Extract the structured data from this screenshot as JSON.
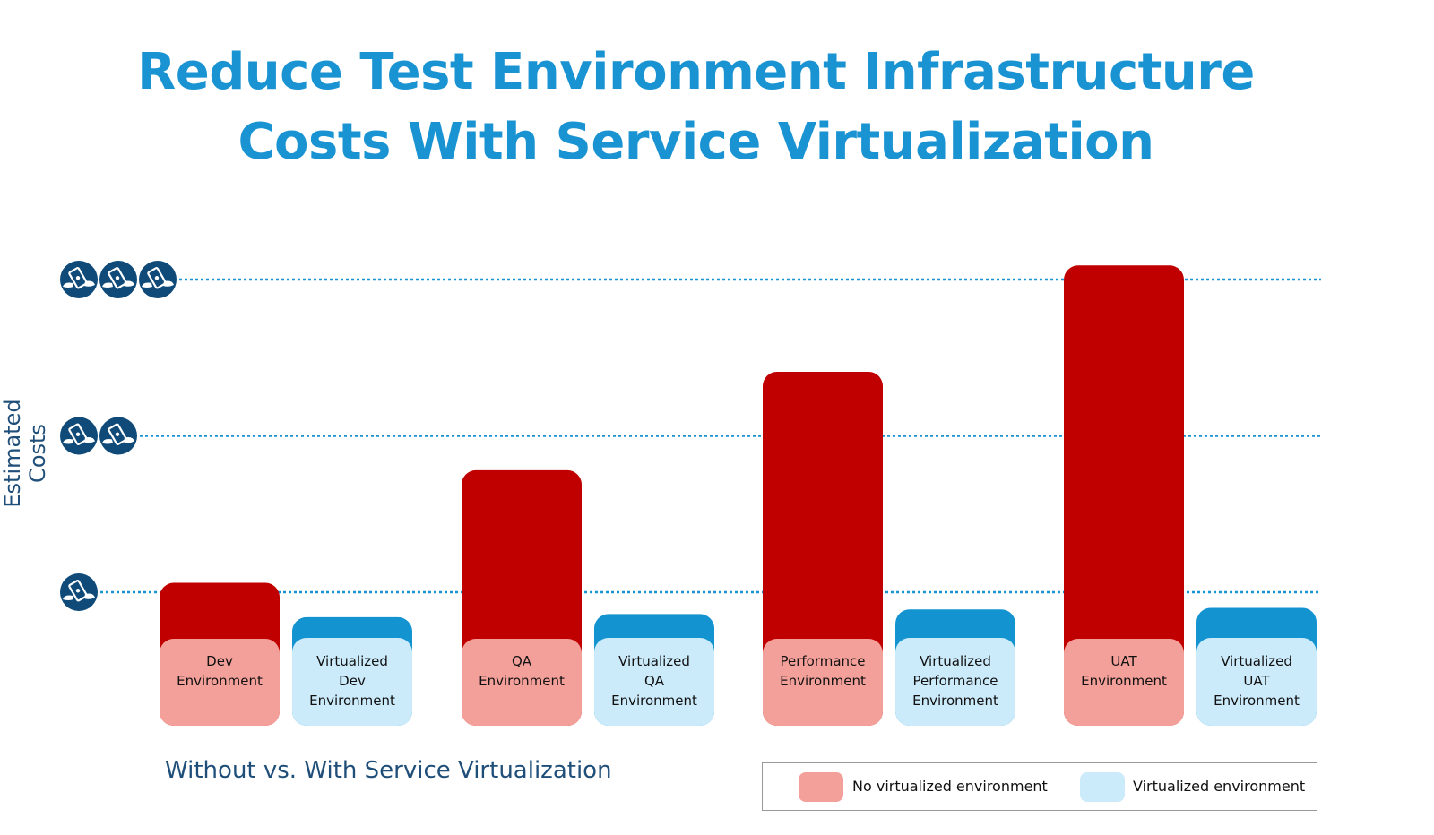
{
  "chart_data": {
    "type": "bar",
    "title": "Reduce Test Environment Infrastructure Costs With Service Virtualization",
    "title_lines": [
      "Reduce Test Environment Infrastructure",
      "Costs With Service Virtualization"
    ],
    "xlabel": "Without vs. With Service Virtualization",
    "ylabel": "Estimated Costs",
    "y_ticks": [
      {
        "value": 1,
        "icon_count": 1,
        "icon": "money-with-wings-icon"
      },
      {
        "value": 2,
        "icon_count": 2,
        "icon": "money-with-wings-icon"
      },
      {
        "value": 3,
        "icon_count": 3,
        "icon": "money-with-wings-icon"
      }
    ],
    "ylim": [
      0.15,
      3.15
    ],
    "grid": "dotted horizontal at ticks",
    "categories": [
      "Dev",
      "QA",
      "Performance",
      "UAT"
    ],
    "series": [
      {
        "name": "No virtualized environment",
        "color": "#c00000",
        "label_color": "#f4a09a",
        "values": [
          1.06,
          1.78,
          2.41,
          3.09
        ],
        "labels": [
          [
            "Dev",
            "Environment"
          ],
          [
            "QA",
            "Environment"
          ],
          [
            "Performance",
            "Environment"
          ],
          [
            "UAT",
            "Environment"
          ]
        ]
      },
      {
        "name": "Virtualized environment",
        "color": "#1493d1",
        "label_color": "#cbeafa",
        "values": [
          0.84,
          0.86,
          0.89,
          0.9
        ],
        "labels": [
          [
            "Virtualized",
            "Dev",
            "Environment"
          ],
          [
            "Virtualized",
            "QA",
            "Environment"
          ],
          [
            "Virtualized",
            "Performance",
            "Environment"
          ],
          [
            "Virtualized",
            "UAT",
            "Environment"
          ]
        ]
      }
    ],
    "legend": {
      "position": "bottom-right",
      "entries": [
        {
          "label": "No virtualized environment",
          "color": "#f4a09a"
        },
        {
          "label": "Virtualized environment",
          "color": "#cbeafa"
        }
      ]
    }
  },
  "colors": {
    "title": "#1a93d2",
    "axis_text": "#1f4e79",
    "icon_bg": "#0f4a78",
    "grid": "#1a93d2"
  }
}
